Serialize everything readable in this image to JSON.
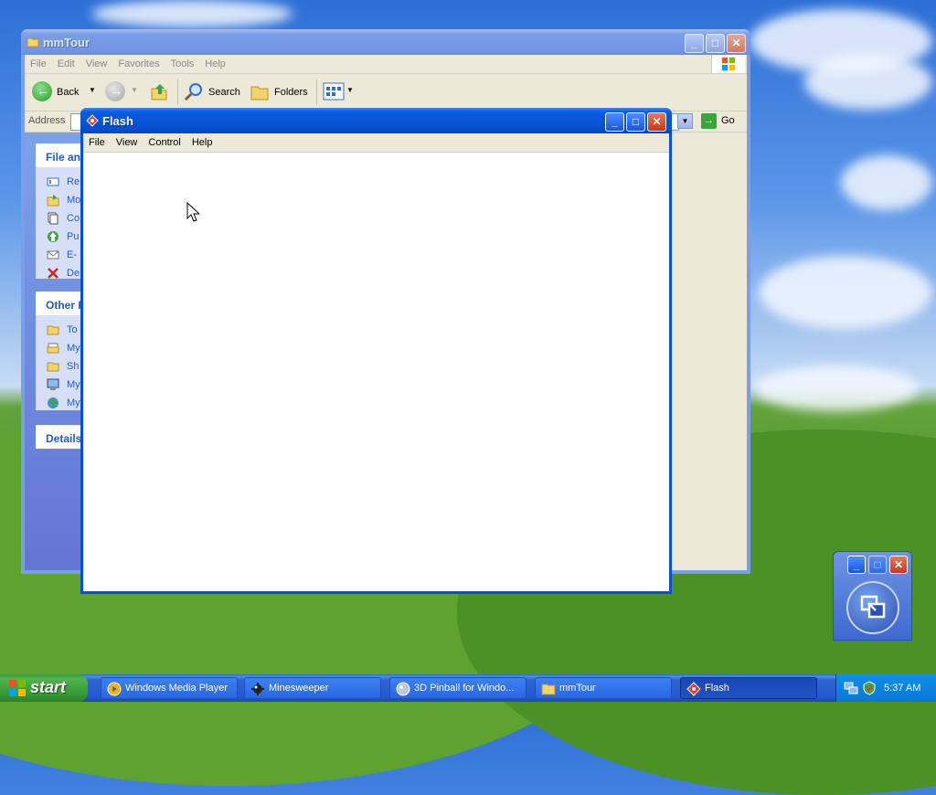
{
  "explorer": {
    "title": "mmTour",
    "menu": [
      "File",
      "Edit",
      "View",
      "Favorites",
      "Tools",
      "Help"
    ],
    "toolbar": {
      "back": "Back",
      "search": "Search",
      "folders": "Folders"
    },
    "address_label": "Address",
    "go_label": "Go",
    "tasks_header": "File an",
    "tasks": [
      "Re",
      "Mo",
      "Co",
      "Pu",
      "E-",
      "De"
    ],
    "other_header": "Other P",
    "other": [
      "To",
      "My",
      "Sh",
      "My",
      "My"
    ],
    "details_header": "Details"
  },
  "flash": {
    "title": "Flash",
    "menu": [
      "File",
      "View",
      "Control",
      "Help"
    ]
  },
  "taskbar": {
    "start": "start",
    "tasks": [
      {
        "label": "Windows Media Player",
        "icon": "media-player-icon"
      },
      {
        "label": "Minesweeper",
        "icon": "minesweeper-icon"
      },
      {
        "label": "3D Pinball for Windo...",
        "icon": "pinball-icon"
      },
      {
        "label": "mmTour",
        "icon": "folder-icon"
      },
      {
        "label": "Flash",
        "icon": "flash-icon"
      }
    ],
    "clock": "5:37 AM"
  },
  "colors": {
    "xp_blue": "#0553d6",
    "start_green": "#379a37",
    "taskpane_link": "#215dc6"
  }
}
